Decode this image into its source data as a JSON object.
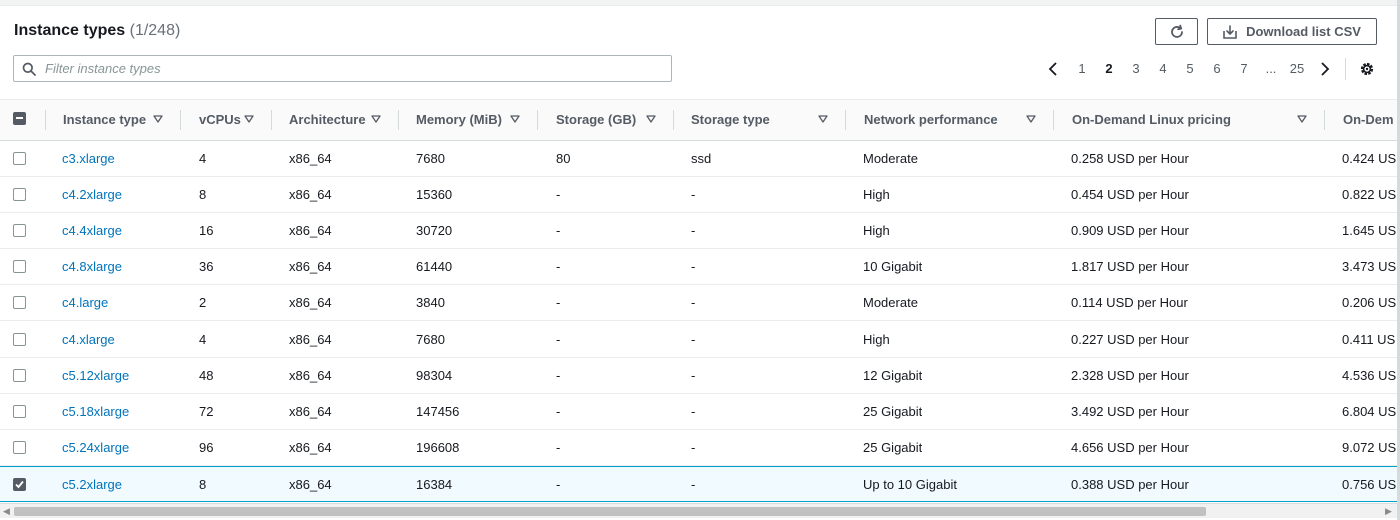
{
  "header": {
    "title": "Instance types",
    "count": "(1/248)",
    "download_label": "Download list CSV",
    "refresh_icon": "refresh-icon",
    "download_icon": "download-icon"
  },
  "filter": {
    "placeholder": "Filter instance types",
    "value": ""
  },
  "pagination": {
    "prev": "‹",
    "pages": [
      "1",
      "2",
      "3",
      "4",
      "5",
      "6",
      "7",
      "...",
      "25"
    ],
    "current": "2",
    "next": "›"
  },
  "table": {
    "columns": [
      "Instance type",
      "vCPUs",
      "Architecture",
      "Memory (MiB)",
      "Storage (GB)",
      "Storage type",
      "Network performance",
      "On-Demand Linux pricing",
      "On-Dem"
    ],
    "rows": [
      {
        "selected": false,
        "cells": [
          "c3.xlarge",
          "4",
          "x86_64",
          "7680",
          "80",
          "ssd",
          "Moderate",
          "0.258 USD per Hour",
          "0.424 US"
        ]
      },
      {
        "selected": false,
        "cells": [
          "c4.2xlarge",
          "8",
          "x86_64",
          "15360",
          "-",
          "-",
          "High",
          "0.454 USD per Hour",
          "0.822 US"
        ]
      },
      {
        "selected": false,
        "cells": [
          "c4.4xlarge",
          "16",
          "x86_64",
          "30720",
          "-",
          "-",
          "High",
          "0.909 USD per Hour",
          "1.645 US"
        ]
      },
      {
        "selected": false,
        "cells": [
          "c4.8xlarge",
          "36",
          "x86_64",
          "61440",
          "-",
          "-",
          "10 Gigabit",
          "1.817 USD per Hour",
          "3.473 US"
        ]
      },
      {
        "selected": false,
        "cells": [
          "c4.large",
          "2",
          "x86_64",
          "3840",
          "-",
          "-",
          "Moderate",
          "0.114 USD per Hour",
          "0.206 US"
        ]
      },
      {
        "selected": false,
        "cells": [
          "c4.xlarge",
          "4",
          "x86_64",
          "7680",
          "-",
          "-",
          "High",
          "0.227 USD per Hour",
          "0.411 US"
        ]
      },
      {
        "selected": false,
        "cells": [
          "c5.12xlarge",
          "48",
          "x86_64",
          "98304",
          "-",
          "-",
          "12 Gigabit",
          "2.328 USD per Hour",
          "4.536 US"
        ]
      },
      {
        "selected": false,
        "cells": [
          "c5.18xlarge",
          "72",
          "x86_64",
          "147456",
          "-",
          "-",
          "25 Gigabit",
          "3.492 USD per Hour",
          "6.804 US"
        ]
      },
      {
        "selected": false,
        "cells": [
          "c5.24xlarge",
          "96",
          "x86_64",
          "196608",
          "-",
          "-",
          "25 Gigabit",
          "4.656 USD per Hour",
          "9.072 US"
        ]
      },
      {
        "selected": true,
        "cells": [
          "c5.2xlarge",
          "8",
          "x86_64",
          "16384",
          "-",
          "-",
          "Up to 10 Gigabit",
          "0.388 USD per Hour",
          "0.756 US"
        ]
      }
    ]
  },
  "colors": {
    "link": "#0073bb",
    "header_text": "#545b64",
    "selected_row_bg": "#f1faff",
    "selected_row_border": "#00a1c9"
  }
}
